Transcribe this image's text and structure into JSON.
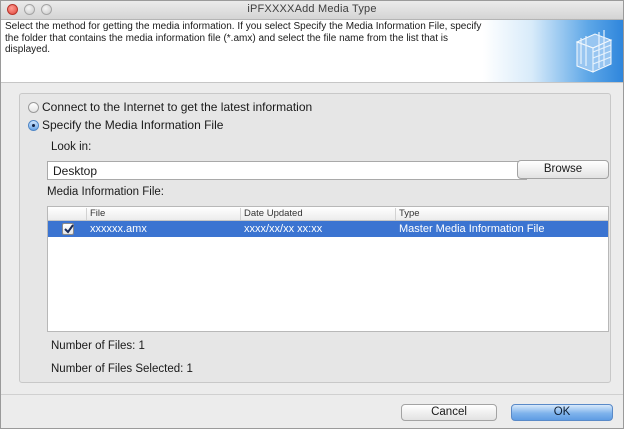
{
  "window": {
    "title": "iPFXXXXAdd Media Type"
  },
  "header": {
    "description": "Select the method for getting the media information. If you select Specify the Media Information File, specify the folder that contains the media information file (*.amx) and select the file name from the list that is displayed."
  },
  "options": [
    {
      "label": "Connect to the Internet to get the latest information",
      "selected": false
    },
    {
      "label": "Specify the Media Information File",
      "selected": true
    }
  ],
  "look_in": {
    "label": "Look in:",
    "value": "Desktop",
    "browse_label": "Browse"
  },
  "media_file": {
    "label": "Media Information File:",
    "columns": [
      "File",
      "Date Updated",
      "Type"
    ],
    "rows": [
      {
        "checked": true,
        "file": "xxxxxx.amx",
        "date": "xxxx/xx/xx xx:xx",
        "type": "Master Media Information File"
      }
    ]
  },
  "status": {
    "files": "Number of Files: 1",
    "selected": "Number of Files Selected: 1"
  },
  "buttons": {
    "cancel": "Cancel",
    "ok": "OK"
  },
  "colors": {
    "selection": "#3b74d1",
    "accent": "#5f9ce3"
  }
}
